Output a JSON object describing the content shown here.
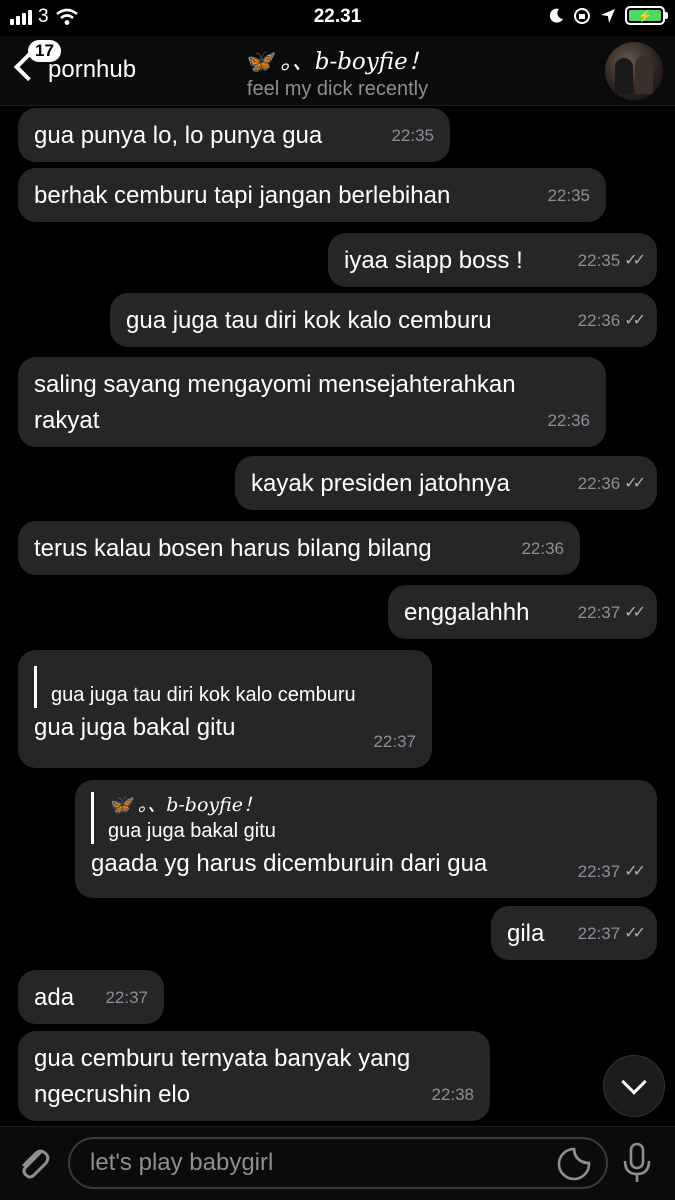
{
  "status_bar": {
    "carrier": "3",
    "time": "22.31",
    "battery_color": "#4cd964"
  },
  "header": {
    "back_badge": "17",
    "back_label": "pornhub",
    "title": "🦋 。、b-boyfie！",
    "subtitle": "feel my dick recently"
  },
  "messages": [
    {
      "text": "gua punya lo, lo punya gua",
      "time": "22:35",
      "dir": "in"
    },
    {
      "text": "berhak cemburu tapi jangan berlebihan",
      "time": "22:35",
      "dir": "in"
    },
    {
      "text": "iyaa siapp boss !",
      "time": "22:35",
      "dir": "out",
      "check": "✓✓"
    },
    {
      "text": "gua juga tau diri kok kalo cemburu",
      "time": "22:36",
      "dir": "out",
      "check": "✓✓"
    },
    {
      "text": "saling sayang mengayomi mensejahterahkan rakyat",
      "time": "22:36",
      "dir": "in"
    },
    {
      "text": "kayak presiden jatohnya",
      "time": "22:36",
      "dir": "out",
      "check": "✓✓"
    },
    {
      "text": "terus kalau bosen harus bilang bilang",
      "time": "22:36",
      "dir": "in"
    },
    {
      "text": "enggalahhh",
      "time": "22:37",
      "dir": "out",
      "check": "✓✓"
    },
    {
      "reply_text": "gua juga tau diri kok kalo cemburu",
      "text": "gua juga bakal gitu",
      "time": "22:37",
      "dir": "in"
    },
    {
      "reply_name": "🦋 。、b-boyfie！",
      "reply_text": "gua juga bakal gitu",
      "text": "gaada yg harus dicemburuin dari gua",
      "time": "22:37",
      "dir": "out",
      "check": "✓✓"
    },
    {
      "text": "gila",
      "time": "22:37",
      "dir": "out",
      "check": "✓✓"
    },
    {
      "text": "ada",
      "time": "22:37",
      "dir": "in"
    },
    {
      "text": "gua cemburu ternyata banyak yang ngecrushin elo",
      "time": "22:38",
      "dir": "in"
    }
  ],
  "input": {
    "placeholder": "let's play babygirl"
  },
  "icons": {
    "back": "chevron-left-icon",
    "scroll": "chevron-down-icon",
    "attach": "paperclip-icon",
    "sticker": "sticker-icon",
    "mic": "microphone-icon"
  }
}
